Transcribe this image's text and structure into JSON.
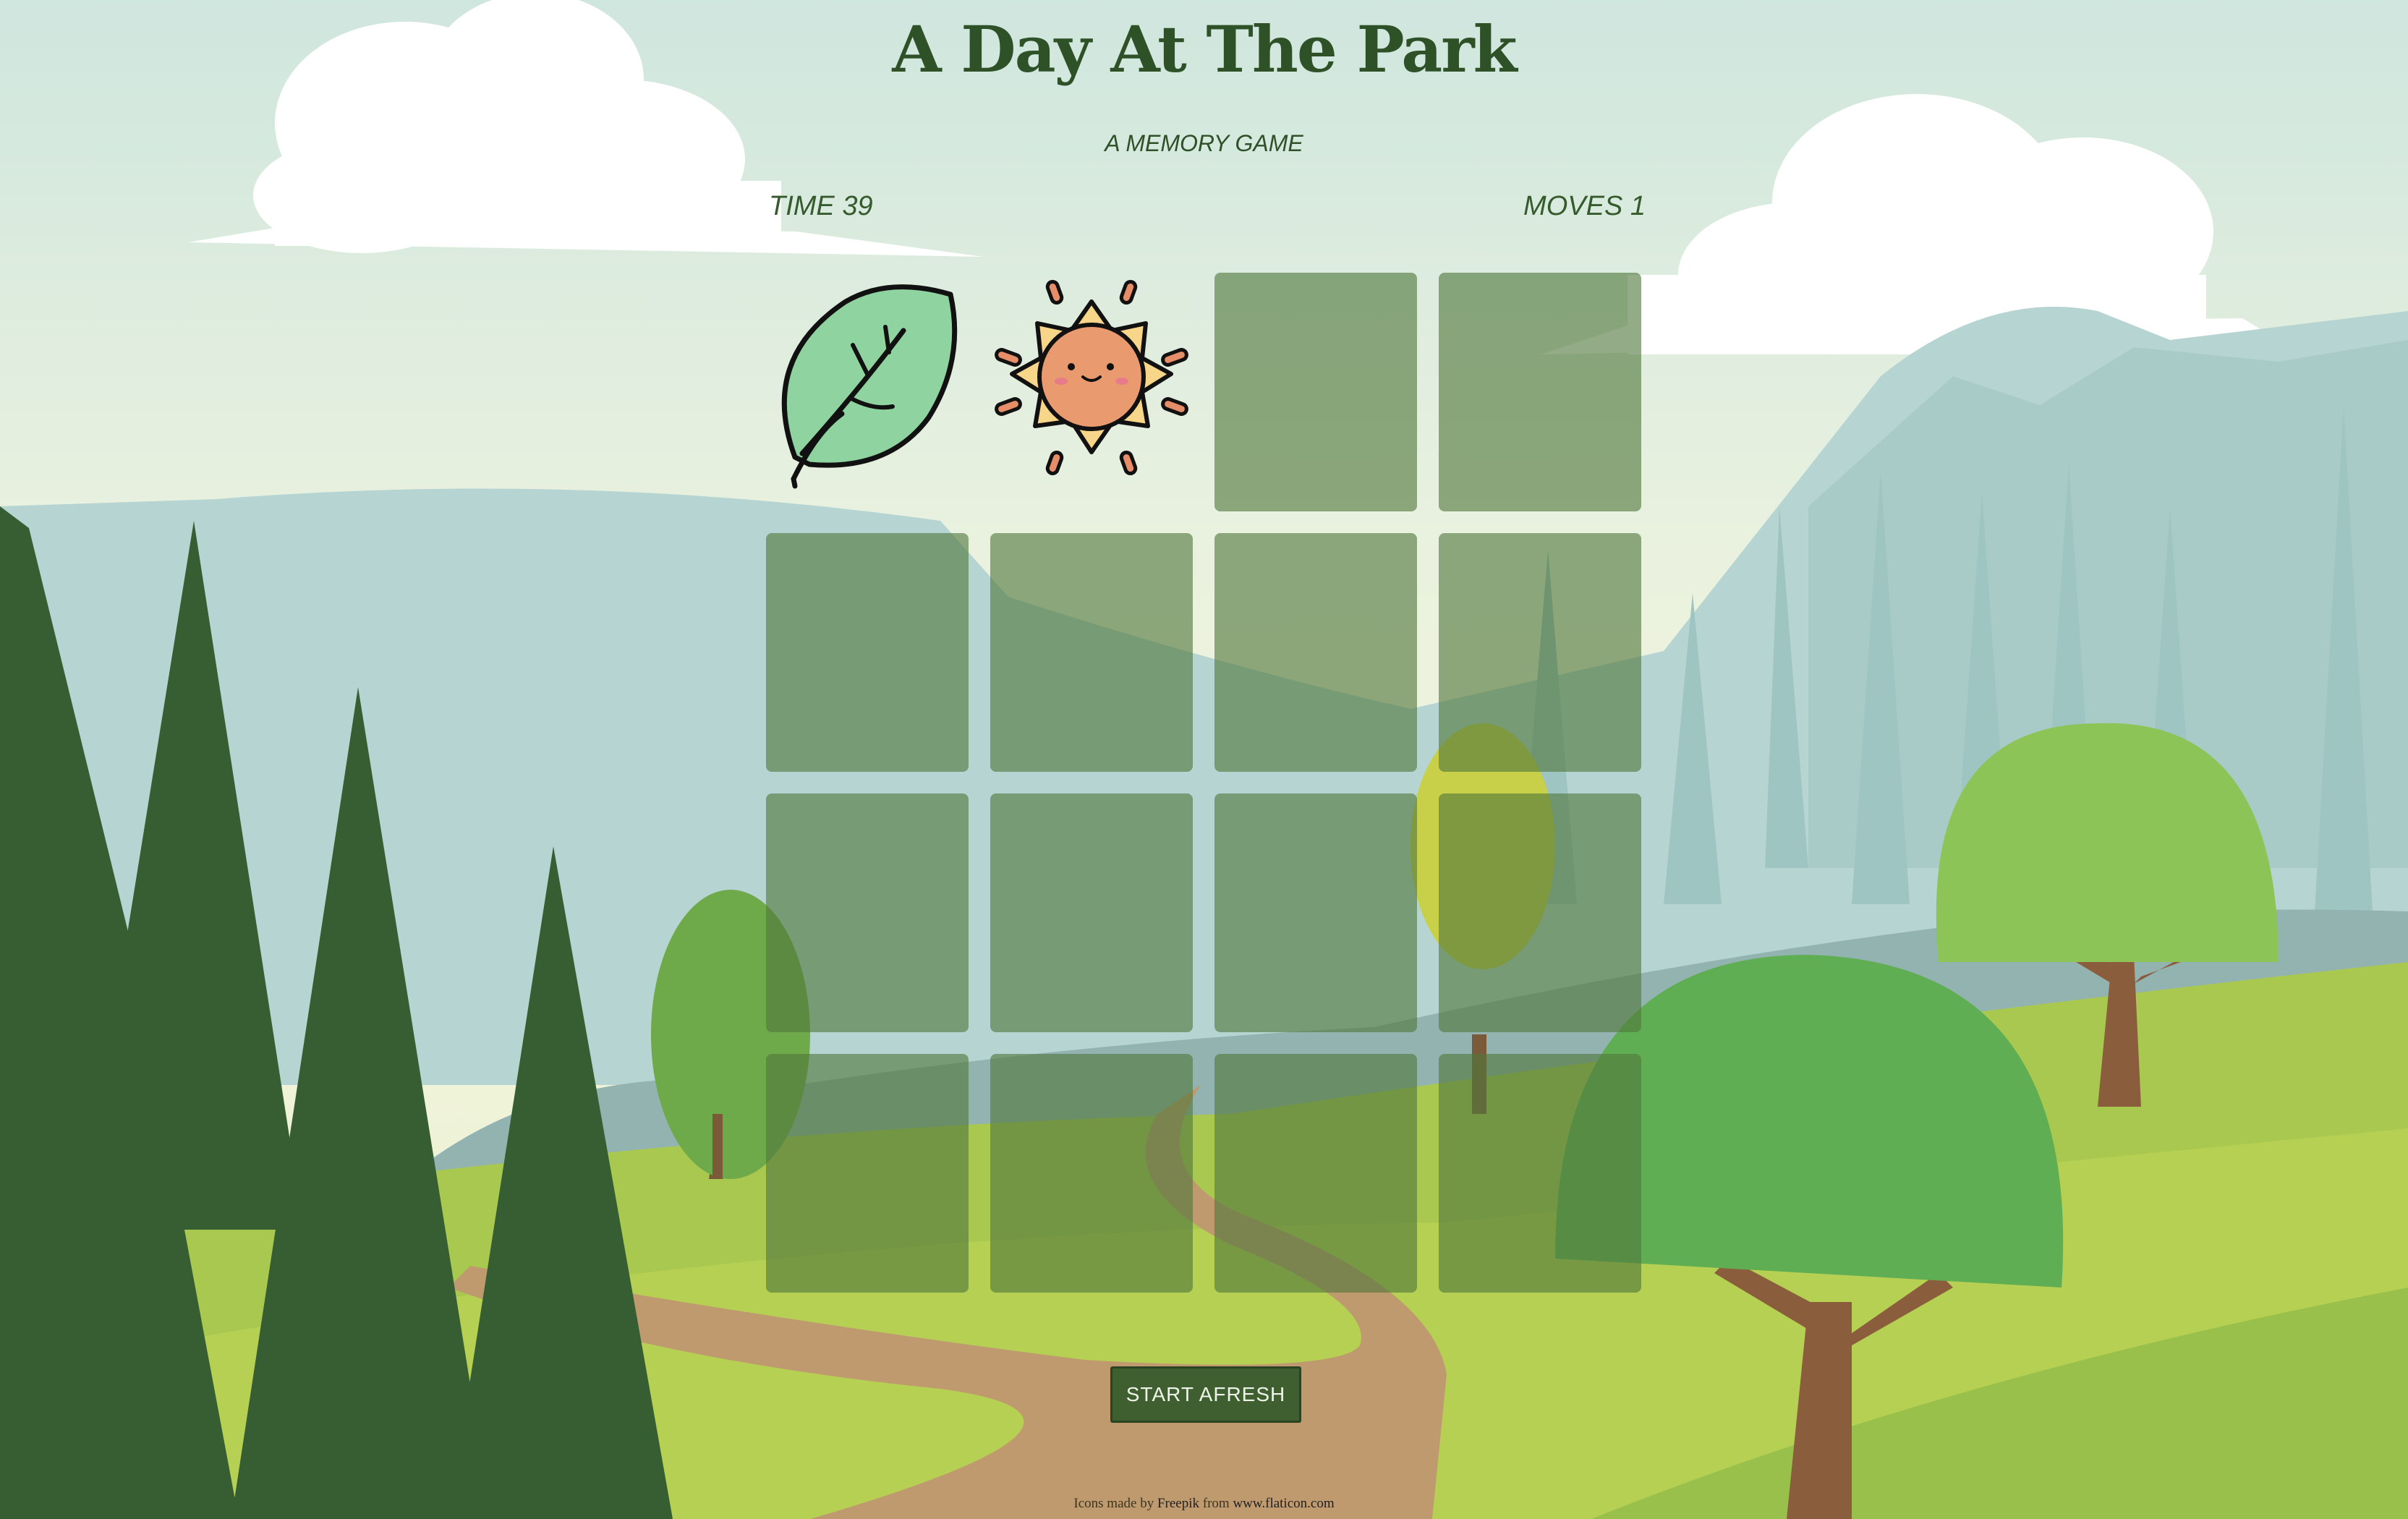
{
  "title": "A Day At The Park",
  "subtitle": "A MEMORY GAME",
  "stats": {
    "time_label": "TIME",
    "time_value": "39",
    "moves_label": "MOVES",
    "moves_value": "1"
  },
  "board": {
    "rows": 4,
    "cols": 4,
    "cards": [
      {
        "state": "flipped",
        "icon": "leaf-icon"
      },
      {
        "state": "flipped",
        "icon": "sun-icon"
      },
      {
        "state": "hidden"
      },
      {
        "state": "hidden"
      },
      {
        "state": "hidden"
      },
      {
        "state": "hidden"
      },
      {
        "state": "hidden"
      },
      {
        "state": "hidden"
      },
      {
        "state": "hidden"
      },
      {
        "state": "hidden"
      },
      {
        "state": "hidden"
      },
      {
        "state": "hidden"
      },
      {
        "state": "hidden"
      },
      {
        "state": "hidden"
      },
      {
        "state": "hidden"
      },
      {
        "state": "hidden"
      }
    ]
  },
  "restart_label": "START AFRESH",
  "credits": {
    "prefix": "Icons made by",
    "author": "Freepik",
    "middle": "from",
    "site": "www.flaticon.com"
  },
  "colors": {
    "title": "#2f5128",
    "card_back": "#50783c",
    "button": "#3f5f31"
  }
}
